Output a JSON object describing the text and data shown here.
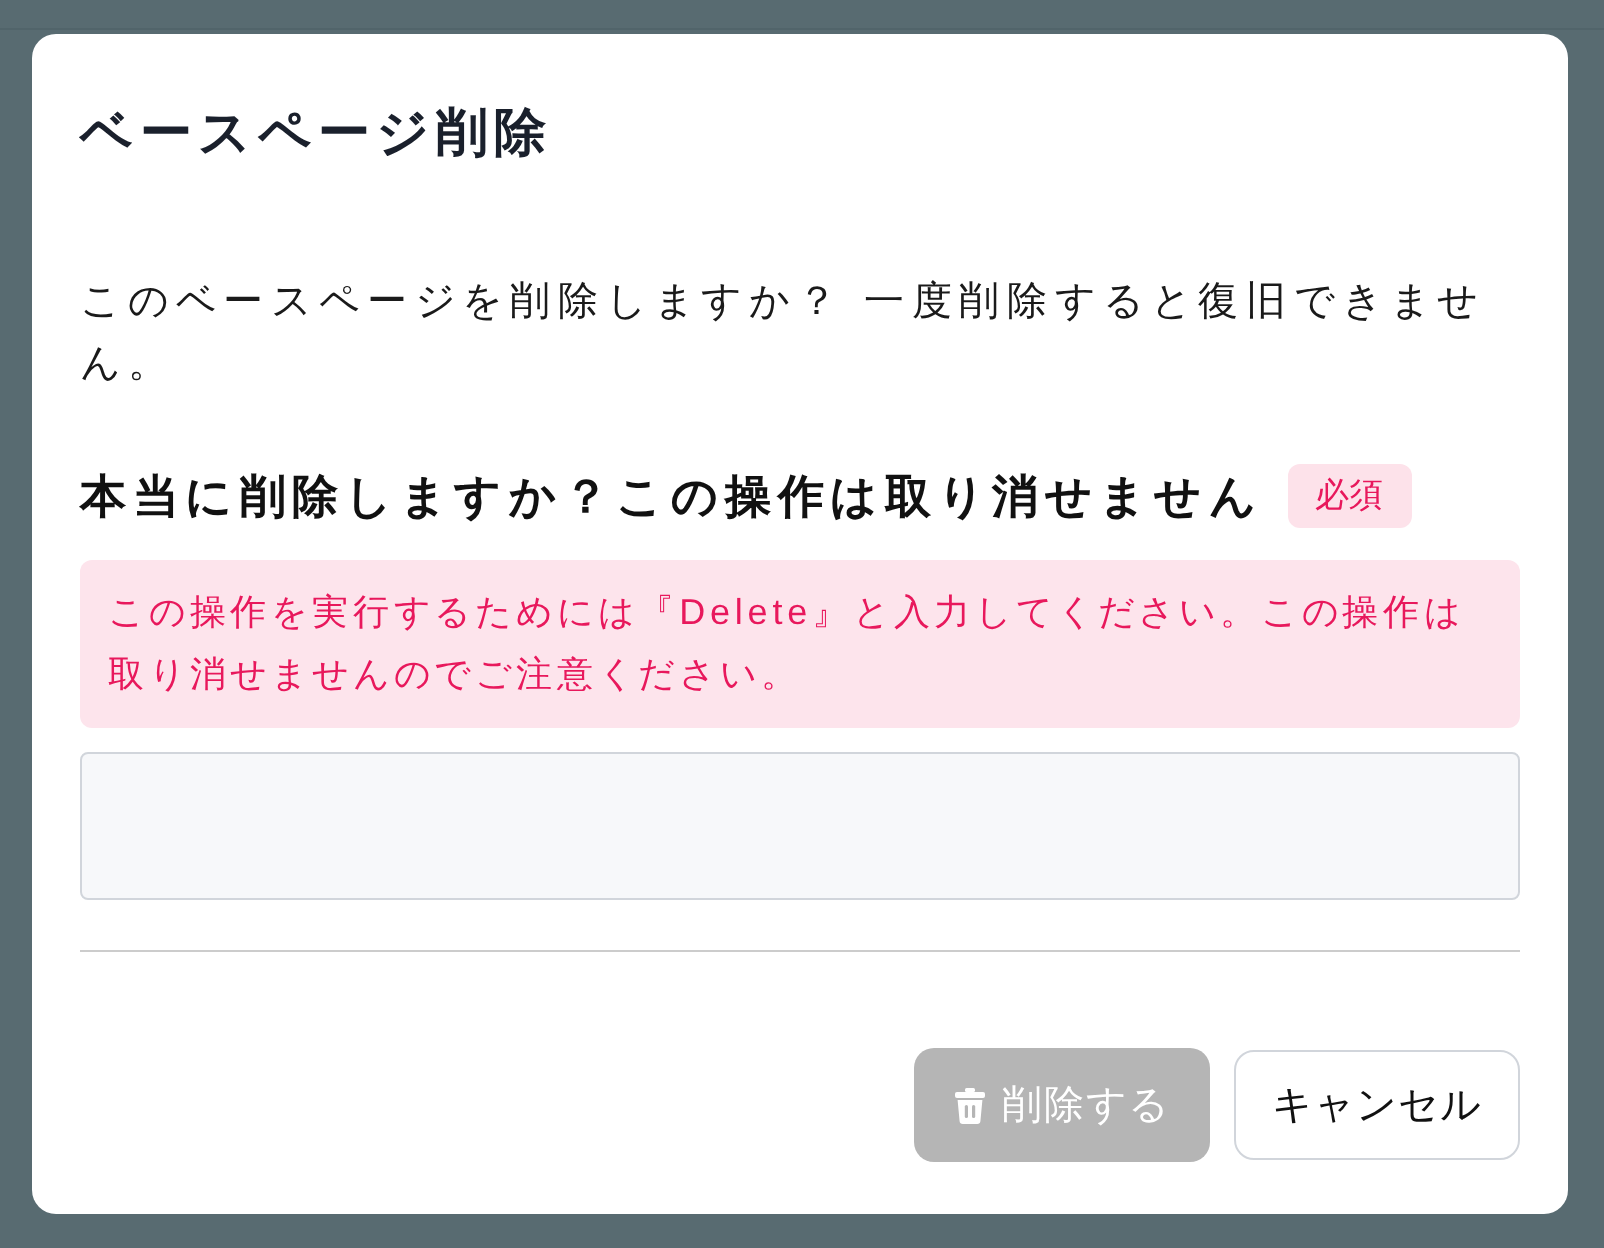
{
  "dialog": {
    "title": "ベースページ削除",
    "message": "このベースページを削除しますか？ 一度削除すると復旧できません。",
    "confirm": {
      "label": "本当に削除しますか？この操作は取り消せません",
      "badge": "必須",
      "warning": "この操作を実行するためには『Delete』と入力してください。この操作は取り消せませんのでご注意ください。"
    },
    "buttons": [
      {
        "kind": "delete",
        "label": "削除する",
        "disabled": true
      },
      {
        "kind": "cancel",
        "label": "キャンセル",
        "disabled": false
      }
    ]
  }
}
